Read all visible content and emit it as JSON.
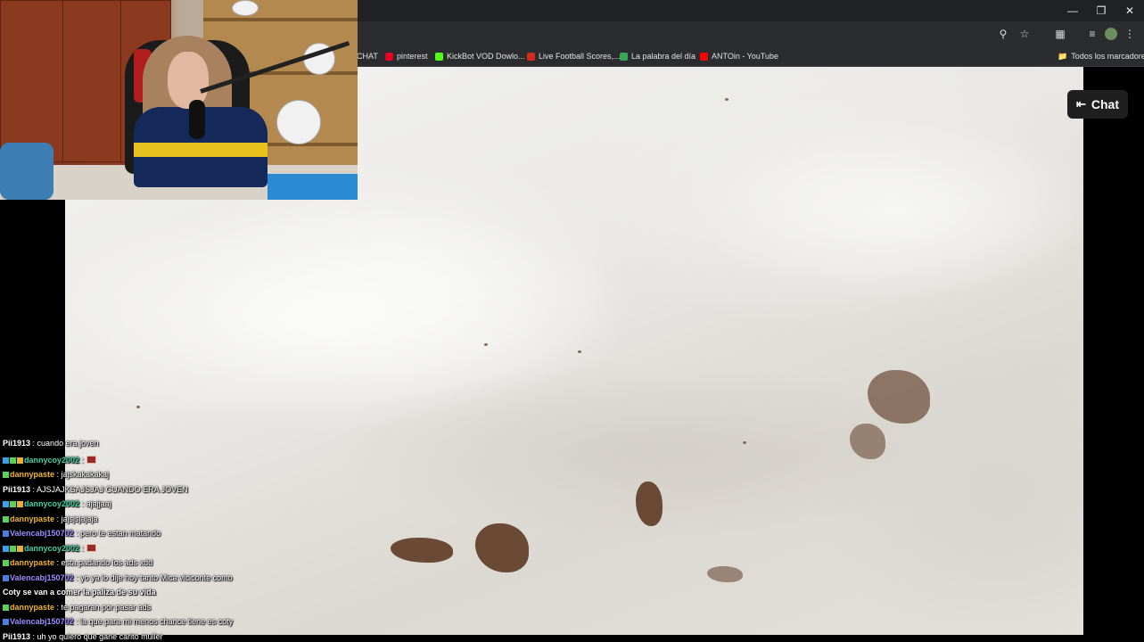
{
  "browser": {
    "window_controls": [
      "minimize",
      "restore",
      "close"
    ],
    "address_icons": [
      "zoom-icon",
      "star-icon",
      "extensions-icon",
      "media-icon",
      "profile-avatar",
      "menu-icon"
    ],
    "bookmarks": [
      {
        "label": "CHAT",
        "color": "#2b2c2f"
      },
      {
        "label": "pinterest",
        "color": "#e60023"
      },
      {
        "label": "KickBot VOD Dowlo...",
        "color": "#53fc18"
      },
      {
        "label": "Live Football Scores,...",
        "color": "#d52b1e"
      },
      {
        "label": "La palabra del día",
        "color": "#3aa757"
      },
      {
        "label": "ANTOin - YouTube",
        "color": "#ff0000"
      }
    ],
    "all_bookmarks_label": "Todos los marcadores"
  },
  "player": {
    "chat_button_label": "Chat"
  },
  "chat": {
    "messages": [
      {
        "badges": [],
        "user": "Pii1913",
        "user_color": "#ffffff",
        "text": "cuando era joven",
        "emote": false
      },
      {
        "badges": [
          "#3aa0e8",
          "#5ad15a",
          "#e5b13a"
        ],
        "user": "dannycoy2002",
        "user_color": "#3fd1a5",
        "text": "",
        "emote": true
      },
      {
        "badges": [
          "#5ad15a"
        ],
        "user": "dannypaste",
        "user_color": "#f0b429",
        "text": "jajskakakakaj",
        "emote": false
      },
      {
        "badges": [],
        "user": "Pii1913",
        "user_color": "#ffffff",
        "text": "AJSJAJKSAJSJAJ CUANDO ERA JOVEN",
        "emote": false
      },
      {
        "badges": [
          "#3aa0e8",
          "#5ad15a",
          "#e5b13a"
        ],
        "user": "dannycoy2002",
        "user_color": "#3fd1a5",
        "text": "ajajjaaj",
        "emote": false
      },
      {
        "badges": [
          "#5ad15a"
        ],
        "user": "dannypaste",
        "user_color": "#f0b429",
        "text": "jajsjsjajaja",
        "emote": false
      },
      {
        "badges": [
          "#4a7fe0"
        ],
        "user": "Valencabj150702",
        "user_color": "#9b8cff",
        "text": "pero te estan matando",
        "emote": false
      },
      {
        "badges": [
          "#3aa0e8",
          "#5ad15a",
          "#e5b13a"
        ],
        "user": "dannycoy2002",
        "user_color": "#3fd1a5",
        "text": "",
        "emote": true
      },
      {
        "badges": [
          "#5ad15a"
        ],
        "user": "dannypaste",
        "user_color": "#f0b429",
        "text": "esta padando los ads xdd",
        "emote": false
      },
      {
        "badges": [
          "#4a7fe0"
        ],
        "user": "Valencabj150702",
        "user_color": "#9b8cff",
        "text": "yo ya lo dije hoy tanto Mica viciconte como",
        "emote": false
      },
      {
        "badges": [],
        "user": "",
        "user_color": "#ffffff",
        "text": "Coty se van a comer la paliza de su vida",
        "emote": false
      },
      {
        "badges": [
          "#5ad15a"
        ],
        "user": "dannypaste",
        "user_color": "#f0b429",
        "text": "te pagaran por pasar ads",
        "emote": false
      },
      {
        "badges": [
          "#4a7fe0"
        ],
        "user": "Valencabj150702",
        "user_color": "#9b8cff",
        "text": "la que para mi menos chance tiene es coty",
        "emote": false
      },
      {
        "badges": [],
        "user": "Pii1913",
        "user_color": "#ffffff",
        "text": "uh yo quiero que gane carito muller",
        "emote": false
      }
    ]
  }
}
